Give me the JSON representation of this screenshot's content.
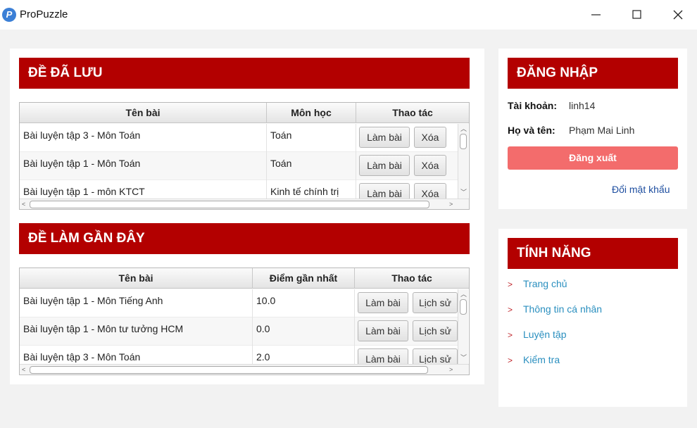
{
  "window": {
    "title": "ProPuzzle",
    "app_icon_letter": "P"
  },
  "saved": {
    "heading": "ĐỀ ĐÃ LƯU",
    "columns": [
      "Tên bài",
      "Môn học",
      "Thao tác"
    ],
    "rows": [
      {
        "name": "Bài luyện tập 3 - Môn Toán",
        "subject": "Toán",
        "action1": "Làm bài",
        "action2": "Xóa"
      },
      {
        "name": "Bài luyện tập 1 - Môn Toán",
        "subject": "Toán",
        "action1": "Làm bài",
        "action2": "Xóa"
      },
      {
        "name": "Bài luyện tập 1 - môn KTCT",
        "subject": "Kinh tế chính trị",
        "action1": "Làm bài",
        "action2": "Xóa"
      }
    ]
  },
  "recent": {
    "heading": "ĐỀ LÀM GẦN ĐÂY",
    "columns": [
      "Tên bài",
      "Điểm gần nhất",
      "Thao tác"
    ],
    "rows": [
      {
        "name": "Bài luyện tập 1 - Môn Tiếng Anh",
        "score": "10.0",
        "action1": "Làm bài",
        "action2": "Lịch sử"
      },
      {
        "name": "Bài luyện tập 1 - Môn tư tưởng HCM",
        "score": "0.0",
        "action1": "Làm bài",
        "action2": "Lịch sử"
      },
      {
        "name": "Bài luyện tập 3 - Môn Toán",
        "score": "2.0",
        "action1": "Làm bài",
        "action2": "Lịch sử"
      }
    ]
  },
  "login": {
    "heading": "ĐĂNG NHẬP",
    "account_label": "Tài khoản:",
    "account_value": "linh14",
    "fullname_label": "Họ và tên:",
    "fullname_value": "Phạm Mai Linh",
    "logout_label": "Đăng xuất",
    "change_password_label": "Đổi mật khẩu"
  },
  "features": {
    "heading": "TÍNH NĂNG",
    "items": [
      "Trang chủ",
      "Thông tin cá nhân",
      "Luyện tập",
      "Kiểm tra"
    ]
  },
  "colors": {
    "header_red": "#b30000",
    "logout_button": "#f36c6c",
    "feature_link": "#2a8fbf",
    "chevron": "#c1272d"
  }
}
